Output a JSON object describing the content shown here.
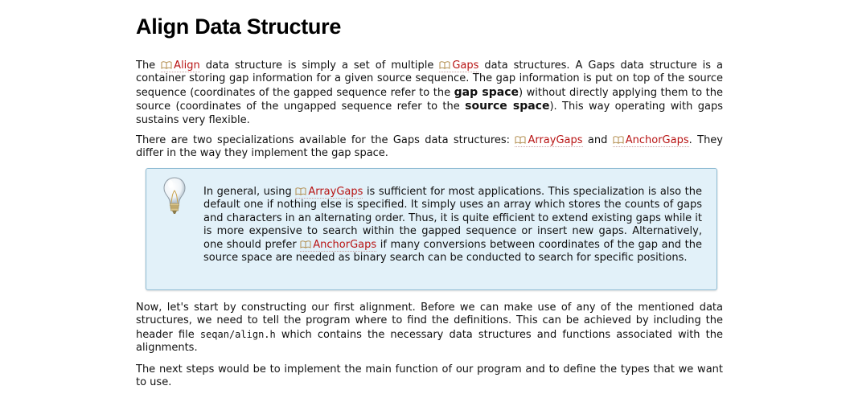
{
  "page": {
    "title": "Align Data Structure"
  },
  "para1": {
    "t1": "The ",
    "link_align": "Align",
    "t2": " data structure is simply a set of multiple ",
    "link_gaps": "Gaps",
    "t3": " data structures. A Gaps data structure is a container storing gap information for a given source sequence. The gap information is put on top of the source sequence (coordinates of the gapped sequence refer to the ",
    "strong_gap_space": "gap space",
    "t4": ") without directly applying them to the source (coordinates of the ungapped sequence refer to the ",
    "strong_source_space": "source space",
    "t5": "). This way operating with gaps sustains very flexible."
  },
  "para2": {
    "t1": "There are two specializations available for the Gaps data structures: ",
    "link_arraygaps": "ArrayGaps",
    "t2": " and ",
    "link_anchorgaps": "AnchorGaps",
    "t3": ". They differ in the way they implement the gap space."
  },
  "callout": {
    "icon": "lightbulb-icon",
    "t1": "In general, using ",
    "link_arraygaps": "ArrayGaps",
    "t2": " is sufficient for most applications. This specialization is also the default one if nothing else is specified. It simply uses an array which stores the counts of gaps and characters in an alternating order. Thus, it is quite efficient to extend existing gaps while it is more expensive to search within the gapped sequence or insert new gaps. Alternatively, one should prefer ",
    "link_anchorgaps": "AnchorGaps",
    "t3": " if many conversions between coordinates of the gap and the source space are needed as binary search can be conducted to search for specific positions."
  },
  "para3": {
    "t1": "Now, let's start by constructing our first alignment. Before we can make use of any of the mentioned data structures, we need to tell the program where to find the definitions. This can be achieved by including the header file ",
    "code": "seqan/align.h",
    "t2": " which contains the necessary data structures and functions associated with the alignments."
  },
  "para4": {
    "t1": "The next steps would be to implement the main function of our program and to define the types that we want to use."
  },
  "colors": {
    "link": "#b81414",
    "callout_background": "#e2f1f9",
    "callout_border": "#8ebbd3"
  },
  "icons": {
    "link_icon": "book-icon"
  }
}
